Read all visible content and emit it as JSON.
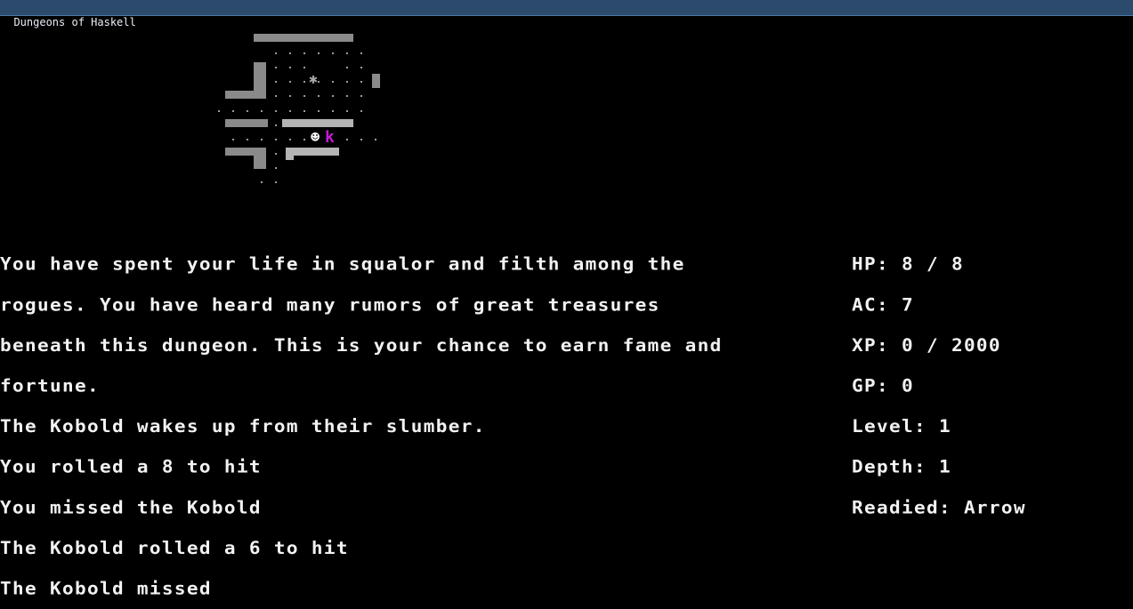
{
  "window": {
    "title": "Dungeons of Haskell"
  },
  "map": {
    "tiles": {
      "floor": "·",
      "wall": "█",
      "trap": "✱"
    },
    "entities": [
      {
        "name": "player",
        "glyph": "☻",
        "color": "#ffffff"
      },
      {
        "name": "Kobold",
        "glyph": "k",
        "color": "#c41bd4"
      },
      {
        "name": "trap",
        "glyph": "✱",
        "color": "#a8a8a8"
      }
    ]
  },
  "messages": [
    "You have spent your life in squalor and filth among the",
    "rogues. You have heard many rumors of great treasures",
    "beneath this dungeon. This is your chance to earn fame and",
    "fortune.",
    "The Kobold wakes up from their slumber.",
    "You rolled a 8 to hit",
    "You missed the Kobold",
    "The Kobold rolled a 6 to hit",
    "The Kobold missed"
  ],
  "stats": {
    "hp": "HP: 8 / 8",
    "ac": "AC: 7",
    "xp": "XP: 0 / 2000",
    "gp": "GP: 0",
    "level": "Level: 1",
    "depth": "Depth: 1",
    "readied": "Readied: Arrow"
  }
}
